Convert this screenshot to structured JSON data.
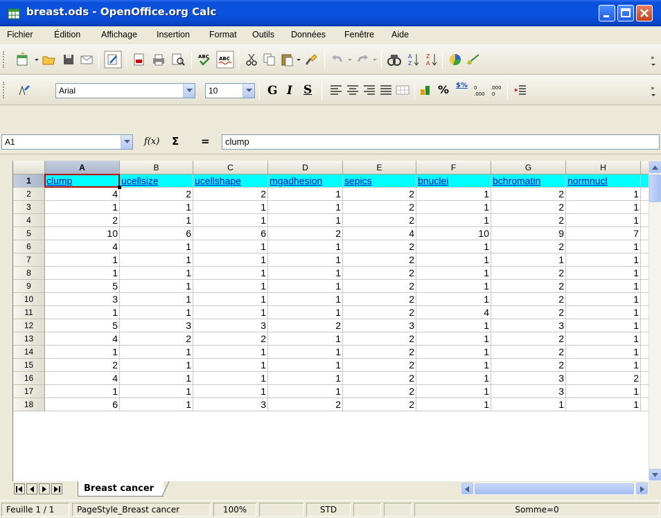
{
  "window": {
    "title": "breast.ods - OpenOffice.org Calc"
  },
  "menu": [
    "Fichier",
    "Édition",
    "Affichage",
    "Insertion",
    "Format",
    "Outils",
    "Données",
    "Fenêtre",
    "Aide"
  ],
  "format_toolbar": {
    "font_name": "Arial",
    "font_size": "10",
    "bold_label": "G",
    "italic_label": "I",
    "underline_label": "S",
    "percent_label": "%",
    "currency_label": "$%"
  },
  "formula_bar": {
    "cell_ref": "A1",
    "fx_label": "f(x)",
    "sum_label": "Σ",
    "equals_label": "=",
    "content": "clump"
  },
  "sheet": {
    "columns": [
      "A",
      "B",
      "C",
      "D",
      "E",
      "F",
      "G",
      "H"
    ],
    "selected_cell": "A1",
    "rows": [
      {
        "n": "1",
        "cells": [
          "clump",
          "ucellsize",
          "ucellshape",
          "mgadhesion",
          "sepics",
          "bnuclei",
          "bchromatin",
          "normnucl"
        ]
      },
      {
        "n": "2",
        "cells": [
          "4",
          "2",
          "2",
          "1",
          "2",
          "1",
          "2",
          "1"
        ]
      },
      {
        "n": "3",
        "cells": [
          "1",
          "1",
          "1",
          "1",
          "2",
          "1",
          "2",
          "1"
        ]
      },
      {
        "n": "4",
        "cells": [
          "2",
          "1",
          "1",
          "1",
          "2",
          "1",
          "2",
          "1"
        ]
      },
      {
        "n": "5",
        "cells": [
          "10",
          "6",
          "6",
          "2",
          "4",
          "10",
          "9",
          "7"
        ]
      },
      {
        "n": "6",
        "cells": [
          "4",
          "1",
          "1",
          "1",
          "2",
          "1",
          "2",
          "1"
        ]
      },
      {
        "n": "7",
        "cells": [
          "1",
          "1",
          "1",
          "1",
          "2",
          "1",
          "1",
          "1"
        ]
      },
      {
        "n": "8",
        "cells": [
          "1",
          "1",
          "1",
          "1",
          "2",
          "1",
          "2",
          "1"
        ]
      },
      {
        "n": "9",
        "cells": [
          "5",
          "1",
          "1",
          "1",
          "2",
          "1",
          "2",
          "1"
        ]
      },
      {
        "n": "10",
        "cells": [
          "3",
          "1",
          "1",
          "1",
          "2",
          "1",
          "2",
          "1"
        ]
      },
      {
        "n": "11",
        "cells": [
          "1",
          "1",
          "1",
          "1",
          "2",
          "4",
          "2",
          "1"
        ]
      },
      {
        "n": "12",
        "cells": [
          "5",
          "3",
          "3",
          "2",
          "3",
          "1",
          "3",
          "1"
        ]
      },
      {
        "n": "13",
        "cells": [
          "4",
          "2",
          "2",
          "1",
          "2",
          "1",
          "2",
          "1"
        ]
      },
      {
        "n": "14",
        "cells": [
          "1",
          "1",
          "1",
          "1",
          "2",
          "1",
          "2",
          "1"
        ]
      },
      {
        "n": "15",
        "cells": [
          "2",
          "1",
          "1",
          "1",
          "2",
          "1",
          "2",
          "1"
        ]
      },
      {
        "n": "16",
        "cells": [
          "4",
          "1",
          "1",
          "1",
          "2",
          "1",
          "3",
          "2"
        ]
      },
      {
        "n": "17",
        "cells": [
          "1",
          "1",
          "1",
          "1",
          "2",
          "1",
          "3",
          "1"
        ]
      },
      {
        "n": "18",
        "cells": [
          "6",
          "1",
          "3",
          "2",
          "2",
          "1",
          "1",
          "1"
        ]
      }
    ]
  },
  "sheet_tab": "Breast cancer",
  "status": {
    "sheet": "Feuille 1 / 1",
    "page_style": "PageStyle_Breast cancer",
    "zoom": "100%",
    "mode": "STD",
    "sum": "Somme=0"
  },
  "colors": {
    "header_fill": "#00ffff",
    "header_text": "#0000cc",
    "cursor": "#c00000",
    "titlebar": "#0b53e0"
  }
}
